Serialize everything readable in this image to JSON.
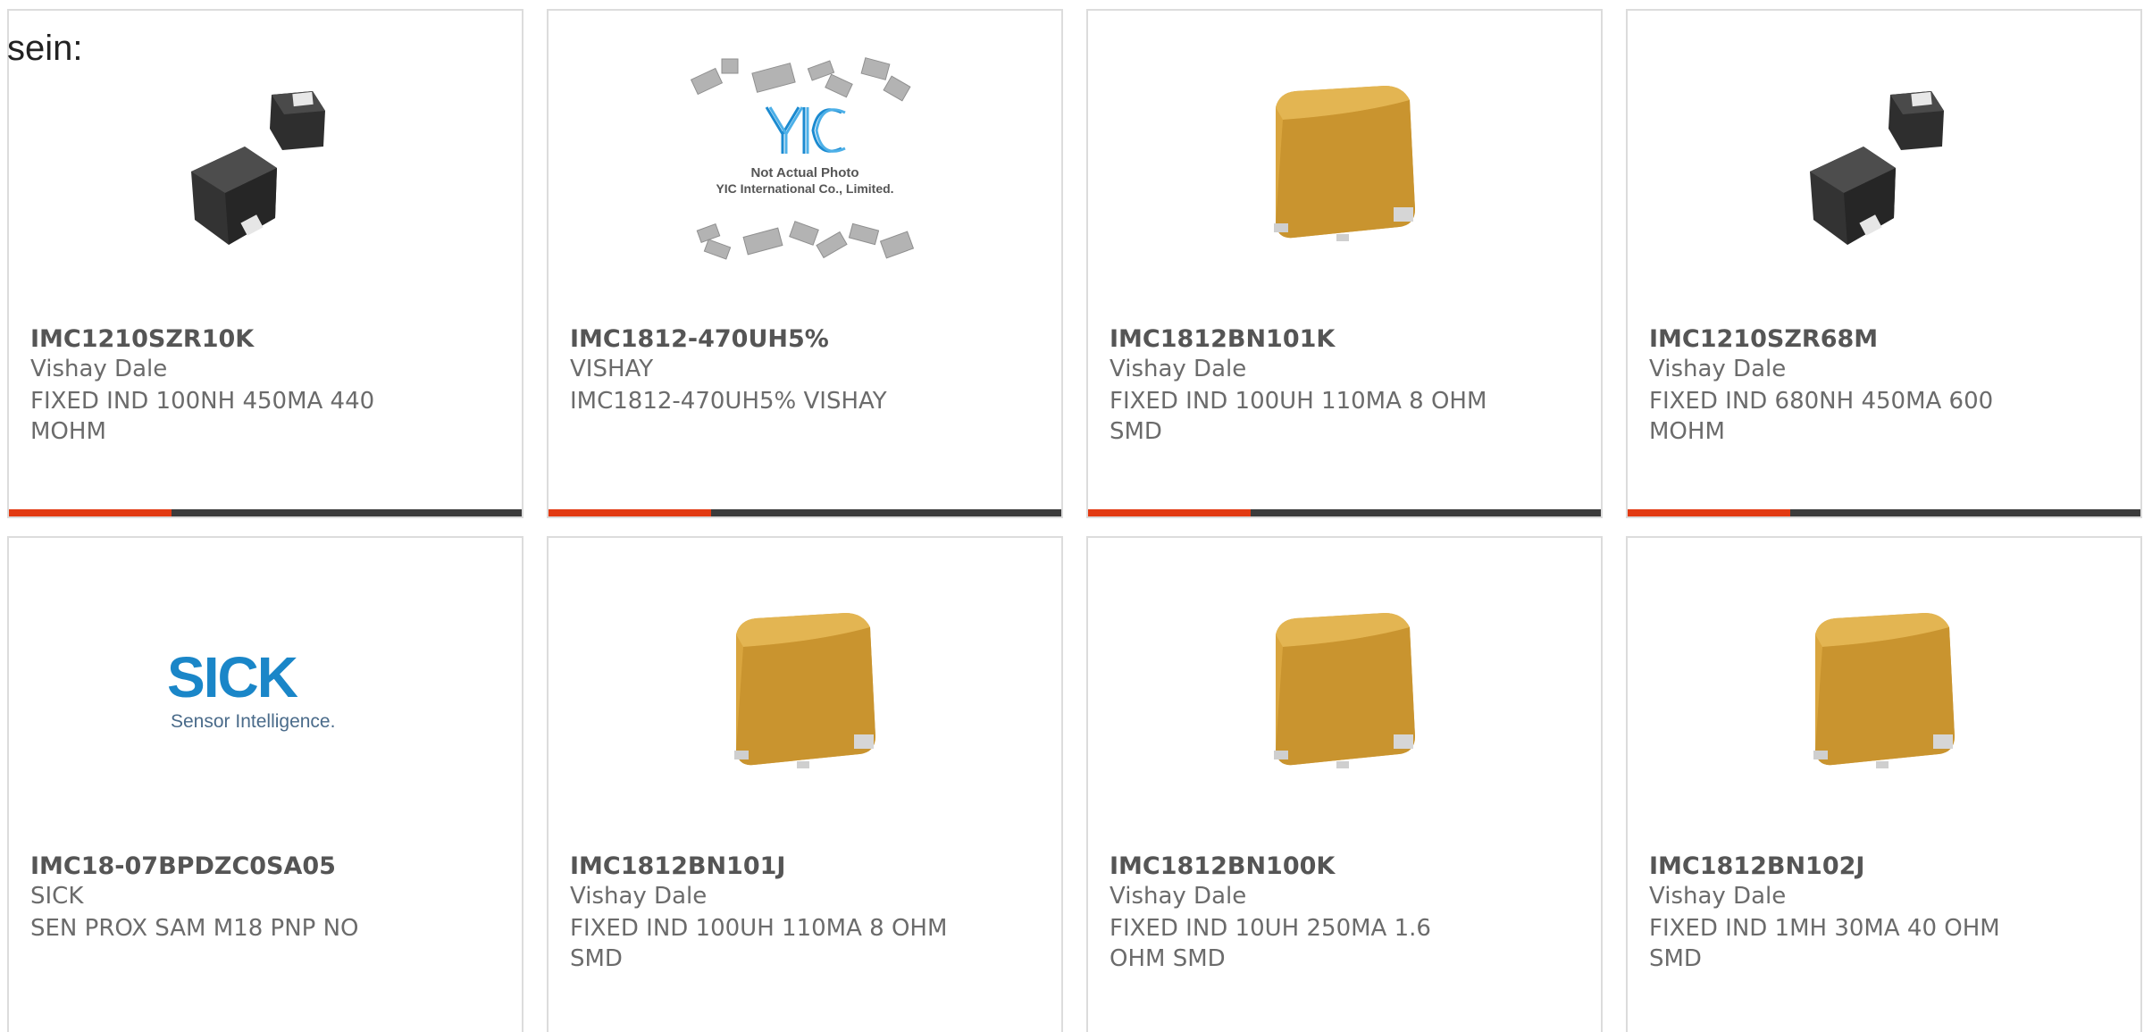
{
  "intro_text": "sein:",
  "colors": {
    "accent": "#e23a12",
    "bar_dark": "#3b3b3b",
    "sick_blue": "#1a86c8",
    "yic_blue": "#1b8ad0",
    "inductor_yellow": "#d9a53e",
    "inductor_black": "#3a3a3a"
  },
  "products": [
    {
      "part": "IMC1210SZR10K",
      "maker": "Vishay Dale",
      "desc": "FIXED IND 100NH 450MA 440 MOHM",
      "image": "black-inductor-pair"
    },
    {
      "part": "IMC1812-470UH5%",
      "maker": "VISHAY",
      "desc": "IMC1812-470UH5% VISHAY",
      "image": "yic-placeholder",
      "image_text": {
        "line1": "Not Actual Photo",
        "line2": "YIC International Co., Limited."
      }
    },
    {
      "part": "IMC1812BN101K",
      "maker": "Vishay Dale",
      "desc": "FIXED IND 100UH 110MA 8 OHM SMD",
      "image": "yellow-inductor"
    },
    {
      "part": "IMC1210SZR68M",
      "maker": "Vishay Dale",
      "desc": "FIXED IND 680NH 450MA 600 MOHM",
      "image": "black-inductor-pair"
    },
    {
      "part": "IMC18-07BPDZC0SA05",
      "maker": "SICK",
      "desc": "SEN PROX SAM M18 PNP NO",
      "image": "sick-logo",
      "image_text": {
        "brand": "SICK",
        "tagline": "Sensor Intelligence."
      }
    },
    {
      "part": "IMC1812BN101J",
      "maker": "Vishay Dale",
      "desc": "FIXED IND 100UH 110MA 8 OHM SMD",
      "image": "yellow-inductor"
    },
    {
      "part": "IMC1812BN100K",
      "maker": "Vishay Dale",
      "desc": "FIXED IND 10UH 250MA 1.6 OHM SMD",
      "image": "yellow-inductor"
    },
    {
      "part": "IMC1812BN102J",
      "maker": "Vishay Dale",
      "desc": "FIXED IND 1MH 30MA 40 OHM SMD",
      "image": "yellow-inductor"
    }
  ]
}
